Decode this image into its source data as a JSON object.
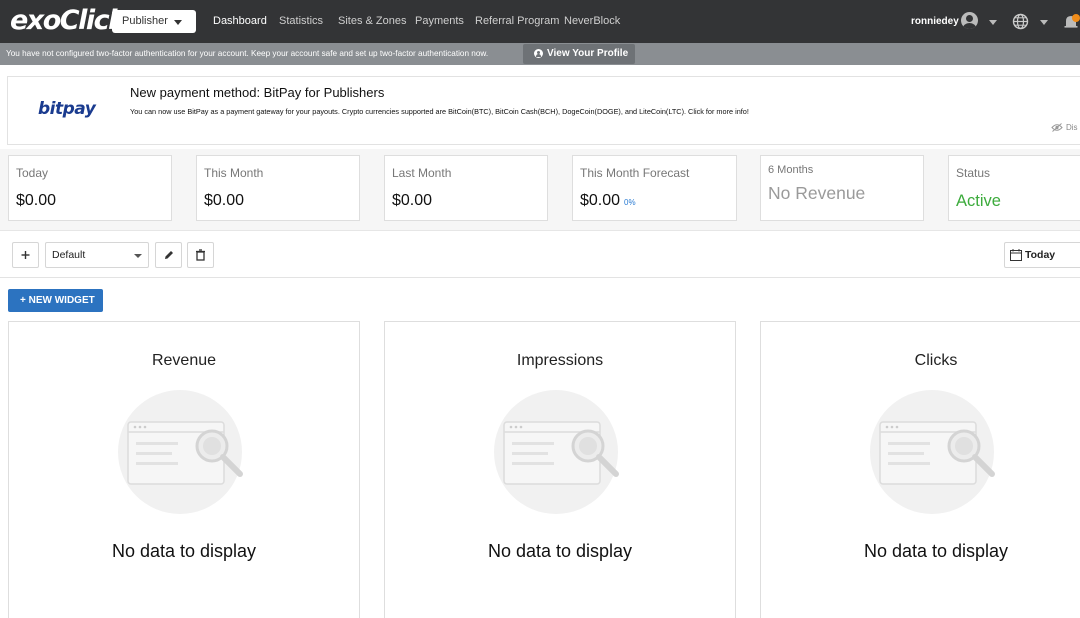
{
  "brand": {
    "logo_text": "exoClick"
  },
  "topnav": {
    "role_select": "Publisher",
    "links": [
      "Dashboard",
      "Statistics",
      "Sites & Zones",
      "Payments",
      "Referral Program",
      "NeverBlock"
    ],
    "active": "Dashboard",
    "username": "ronniedey"
  },
  "alert": {
    "message": "You have not configured two-factor authentication for your account. Keep your account safe and set up two-factor authentication now.",
    "button": "View Your Profile"
  },
  "promo": {
    "logo": "bitpay",
    "title": "New payment method: BitPay for Publishers",
    "text": "You can now use BitPay as a payment gateway for your payouts. Crypto currencies supported are BitCoin(BTC), BitCoin Cash(BCH), DogeCoin(DOGE), and LiteCoin(LTC). Click for more info!",
    "dismiss": "Dis"
  },
  "stats": [
    {
      "label": "Today",
      "value": "$0.00"
    },
    {
      "label": "This Month",
      "value": "$0.00"
    },
    {
      "label": "Last Month",
      "value": "$0.00"
    },
    {
      "label": "This Month Forecast",
      "value": "$0.00",
      "pct": "0%"
    },
    {
      "label": "6 Months",
      "value": "No Revenue"
    },
    {
      "label": "Status",
      "value": "Active"
    }
  ],
  "toolbar": {
    "dashboard_select": "Default",
    "date_range": "Today",
    "new_widget": "+ NEW WIDGET"
  },
  "widgets": [
    {
      "title": "Revenue",
      "empty": "No data to display"
    },
    {
      "title": "Impressions",
      "empty": "No data to display"
    },
    {
      "title": "Clicks",
      "empty": "No data to display"
    }
  ],
  "colors": {
    "nav_bg": "#333436",
    "accent": "#2c73c0",
    "active_green": "#3cab3c"
  }
}
